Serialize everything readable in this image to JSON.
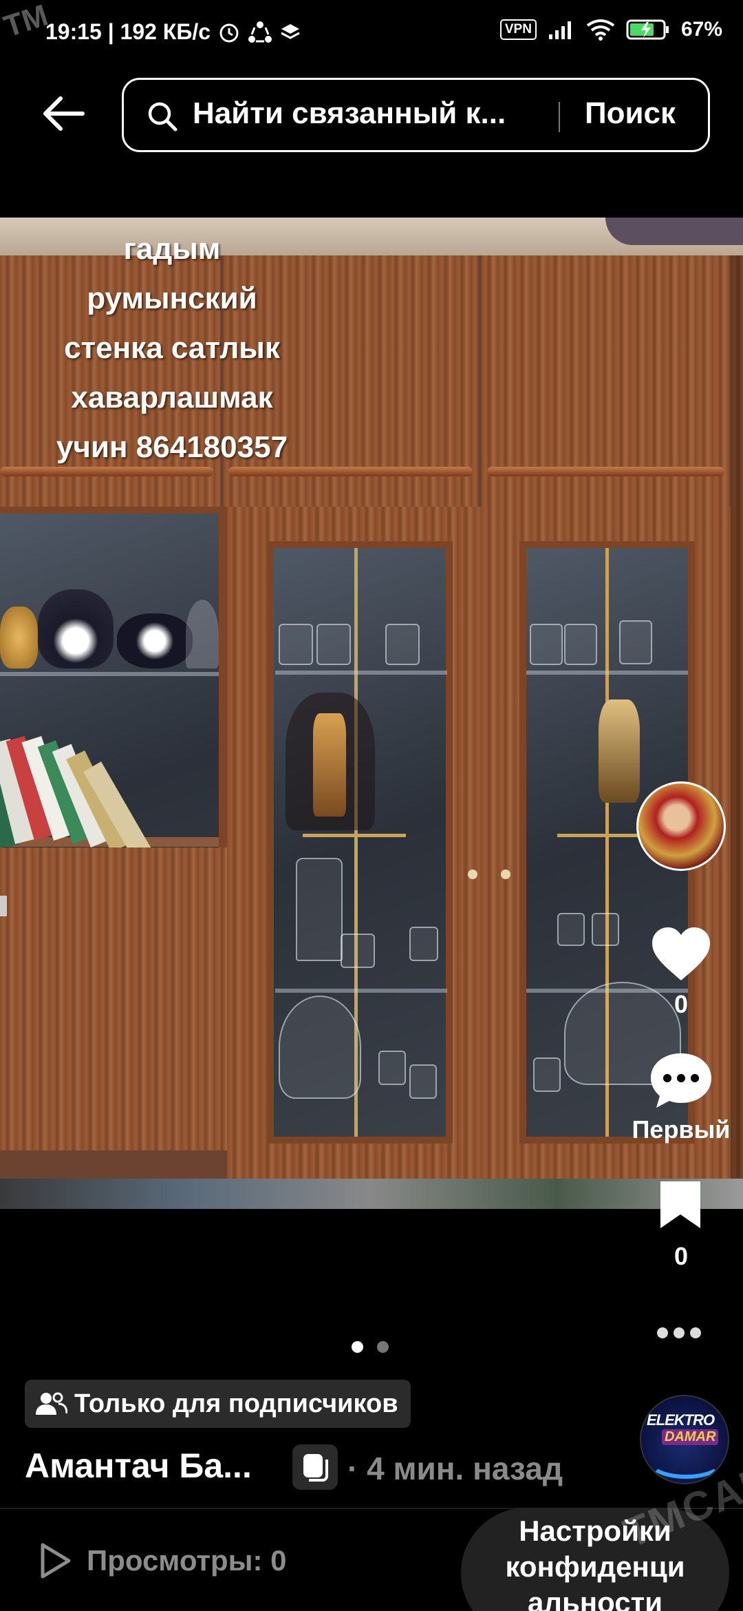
{
  "status_bar": {
    "time_speed": "19:15 | 192 КБ/с",
    "vpn": "VPN",
    "battery": "67%"
  },
  "watermarks": {
    "top_left": "TM",
    "bottom_right": "TMCARS"
  },
  "search": {
    "placeholder": "Найти связанный к...",
    "button": "Поиск"
  },
  "post": {
    "overlay_text_lines": [
      "гадым",
      "румынский",
      "стенка сатлык",
      "хаварлашмак",
      "учин 864180357"
    ],
    "subscribers_only": "Только для подписчиков",
    "author": "Амантач Ба...",
    "time_ago": "· 4 мин. назад",
    "views": "Просмотры: 0",
    "privacy_settings": "Настройки конфиденци альности",
    "brand_logo_text": [
      "ELEKTRO",
      "DAMAR"
    ]
  },
  "rail": {
    "likes": "0",
    "comments": "Первый",
    "saves": "0"
  },
  "pager": {
    "count": 2,
    "active": 1
  },
  "colors": {
    "background": "#000000",
    "muted": "#8a8a8a",
    "badge_bg": "#2b2b2b",
    "pill_bg": "#222222"
  }
}
